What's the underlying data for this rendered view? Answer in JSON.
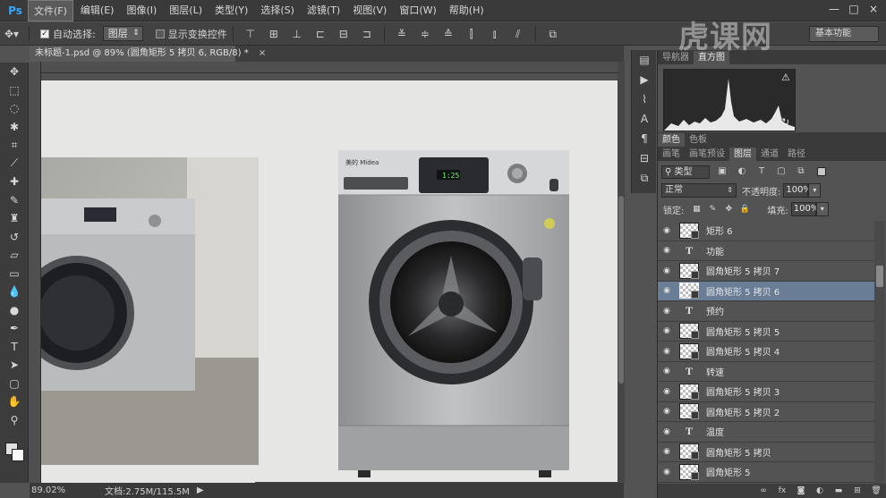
{
  "app": {
    "logo": "Ps",
    "menu": [
      "文件(F)",
      "编辑(E)",
      "图像(I)",
      "图层(L)",
      "类型(Y)",
      "选择(S)",
      "滤镜(T)",
      "视图(V)",
      "窗口(W)",
      "帮助(H)"
    ],
    "active_menu_index": 0,
    "window_controls": [
      "—",
      "□",
      "×"
    ]
  },
  "options_bar": {
    "auto_select_label": "自动选择:",
    "auto_select_checked": true,
    "auto_select_target": "图层",
    "show_transform_label": "显示变换控件",
    "show_transform_checked": false,
    "workspace": "基本功能"
  },
  "document": {
    "tab_title": "未标题-1.psd @ 89% (圆角矩形 5 拷贝 6, RGB/8) *",
    "close_glyph": "×",
    "brand_label": "美的 Midea",
    "display_time": "1:25"
  },
  "status": {
    "zoom": "89.02%",
    "doc_size": "文档:2.75M/115.5M",
    "arrow": "▶"
  },
  "panels": {
    "top_tabs": [
      "导航器",
      "直方图"
    ],
    "top_active": 1,
    "color_tabs": [
      "颜色",
      "色板"
    ],
    "color_active": 0,
    "layer_tabs": [
      "画笔",
      "画笔预设",
      "图层",
      "通道",
      "路径"
    ],
    "layer_active": 2,
    "filter_kind": "类型",
    "blend_mode": "正常",
    "opacity_label": "不透明度:",
    "opacity_value": "100%",
    "lock_label": "锁定:",
    "fill_label": "填充:",
    "fill_value": "100%",
    "layers": [
      {
        "name": "矩形 6",
        "kind": "shape",
        "selected": false
      },
      {
        "name": "功能",
        "kind": "text",
        "selected": false
      },
      {
        "name": "圆角矩形 5 拷贝 7",
        "kind": "shape",
        "selected": false
      },
      {
        "name": "圆角矩形 5 拷贝 6",
        "kind": "shape",
        "selected": true
      },
      {
        "name": "预约",
        "kind": "text",
        "selected": false
      },
      {
        "name": "圆角矩形 5 拷贝 5",
        "kind": "shape",
        "selected": false
      },
      {
        "name": "圆角矩形 5 拷贝 4",
        "kind": "shape",
        "selected": false
      },
      {
        "name": "转速",
        "kind": "text",
        "selected": false
      },
      {
        "name": "圆角矩形 5 拷贝 3",
        "kind": "shape",
        "selected": false
      },
      {
        "name": "圆角矩形 5 拷贝 2",
        "kind": "shape",
        "selected": false
      },
      {
        "name": "温度",
        "kind": "text",
        "selected": false
      },
      {
        "name": "圆角矩形 5 拷贝",
        "kind": "shape",
        "selected": false
      },
      {
        "name": "圆角矩形 5",
        "kind": "shape",
        "selected": false
      }
    ]
  },
  "watermark": "虎课网",
  "colors": {
    "accent": "#31a8ff",
    "selected_layer": "#6a7d96",
    "panel_bg": "#535353",
    "canvas_paper": "#e6e7e5"
  }
}
